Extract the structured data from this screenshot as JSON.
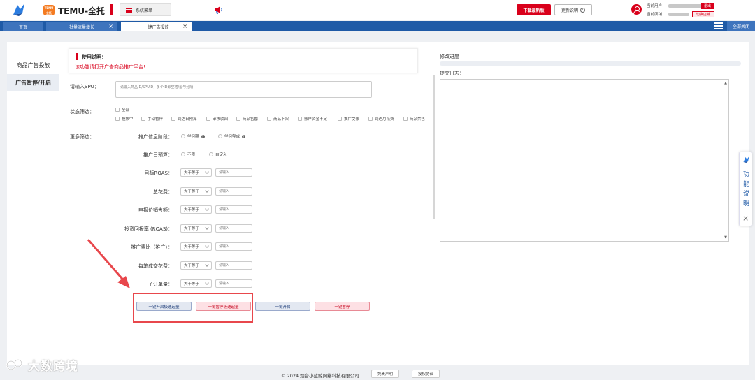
{
  "header": {
    "badge_text": "TEMU全托",
    "app_title": "TEMU-全托",
    "system_menu": "系统菜单",
    "download_btn": "下载最新版",
    "update_btn": "更新说明",
    "current_user_label": "当前用户：",
    "current_store_label": "当前店铺：",
    "logout_btn": "退出",
    "switch_store_btn": "切换店铺"
  },
  "tabs": {
    "home": "首页",
    "batch": "批量流量增长",
    "one_click": "一键广告投放",
    "close_all": "全部关闭"
  },
  "sidebar": {
    "items": [
      {
        "label": "商品广告投放"
      },
      {
        "label": "广告暂停/开启"
      }
    ]
  },
  "notice": {
    "title": "使用说明：",
    "text": "该功能请打开广告商品推广平台!"
  },
  "form": {
    "spu_label": "请输入SPU：",
    "spu_placeholder": "请输入商品ID/SPUID，多个ID即空格/逗号分隔",
    "status_label": "状态筛选：",
    "status_all": "全部",
    "status_options": [
      "投放中",
      "手动暂停",
      "到达日预算",
      "审核驳回",
      "商品售罄",
      "商品下架",
      "账户资金不足",
      "推广受限",
      "到达月花费",
      "商品禁售"
    ],
    "more_label": "更多筛选：",
    "stage_label": "推广信息阶段：",
    "stage_options": [
      "学习期",
      "学习完成"
    ],
    "budget_label": "推广日预算：",
    "budget_options": [
      "不限",
      "自定义"
    ],
    "filters": [
      {
        "label": "目标ROAS："
      },
      {
        "label": "总花费："
      },
      {
        "label": "申报价销售额："
      },
      {
        "label": "投资回报率 (ROAS)："
      },
      {
        "label": "推广费比（推广）："
      },
      {
        "label": "每笔成交花费："
      },
      {
        "label": "子订单量："
      }
    ],
    "operator": "大于等于",
    "input_placeholder": "请输入"
  },
  "actions": {
    "fast_start": "一键开启极速起量",
    "fast_pause": "一键暂停极速起量",
    "start": "一键开启",
    "pause": "一键暂停"
  },
  "right": {
    "progress_label": "修改进度",
    "progress_value": 0,
    "log_label": "提交日志："
  },
  "func_panel": {
    "chars": [
      "功",
      "能",
      "说",
      "明"
    ]
  },
  "footer": {
    "copyright": "© 2024 烟台小蓝鲸网络科技有限公司",
    "disclaimer": "免责声明",
    "license": "授权协议"
  },
  "watermark": "大数跨境",
  "colors": {
    "brand_red": "#d9001b",
    "tab_blue": "#1f5aa6",
    "annotation_red": "#e8474c"
  }
}
